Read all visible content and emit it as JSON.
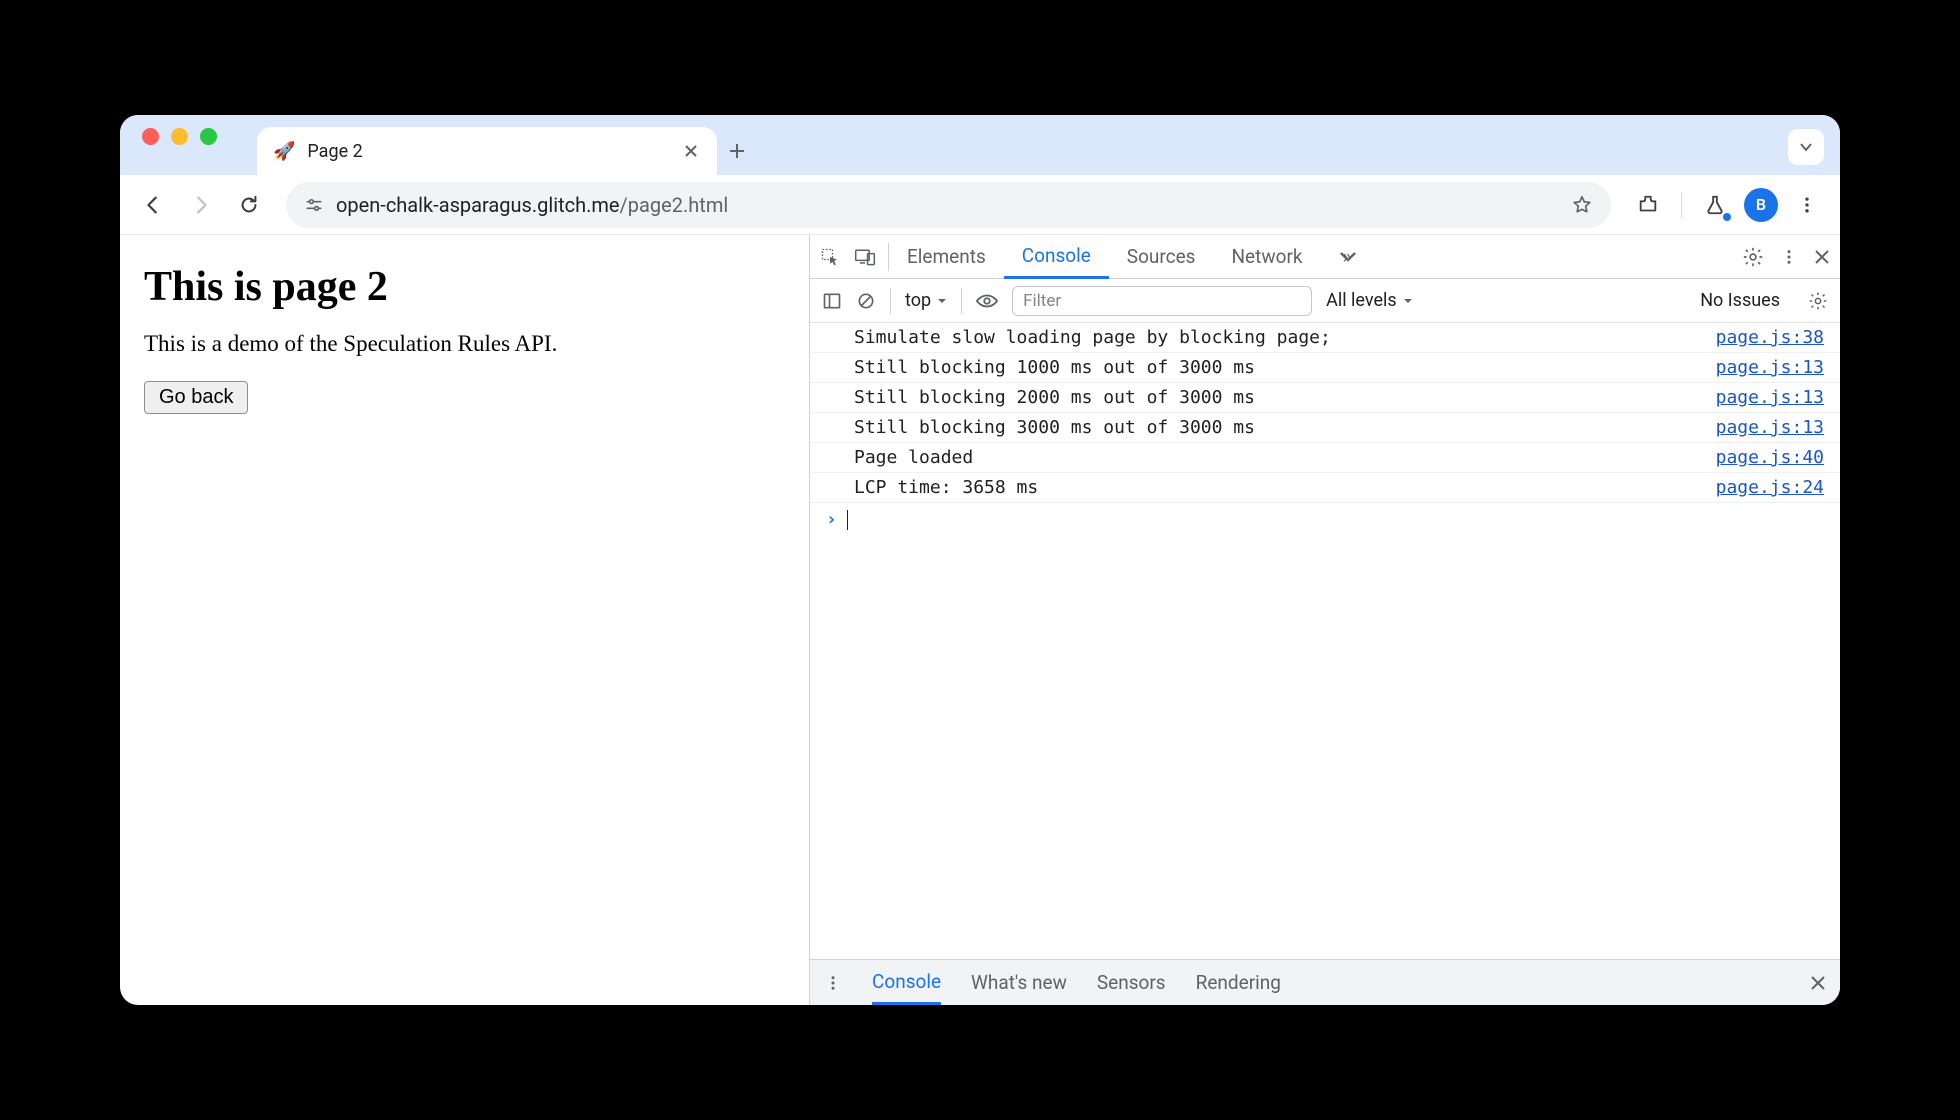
{
  "browser": {
    "tab": {
      "favicon": "🚀",
      "title": "Page 2"
    },
    "url_host": "open-chalk-asparagus.glitch.me",
    "url_path": "/page2.html",
    "avatar_letter": "B"
  },
  "page": {
    "heading": "This is page 2",
    "paragraph": "This is a demo of the Speculation Rules API.",
    "back_button": "Go back"
  },
  "devtools": {
    "tabs": [
      "Elements",
      "Console",
      "Sources",
      "Network"
    ],
    "active_tab": "Console",
    "toolbar": {
      "context": "top",
      "filter_placeholder": "Filter",
      "levels": "All levels",
      "issues": "No Issues"
    },
    "logs": [
      {
        "msg": "Simulate slow loading page by blocking page;",
        "src": "page.js:38"
      },
      {
        "msg": "Still blocking 1000 ms out of 3000 ms",
        "src": "page.js:13"
      },
      {
        "msg": "Still blocking 2000 ms out of 3000 ms",
        "src": "page.js:13"
      },
      {
        "msg": "Still blocking 3000 ms out of 3000 ms",
        "src": "page.js:13"
      },
      {
        "msg": "Page loaded",
        "src": "page.js:40"
      },
      {
        "msg": "LCP time: 3658 ms",
        "src": "page.js:24"
      }
    ],
    "drawer_tabs": [
      "Console",
      "What's new",
      "Sensors",
      "Rendering"
    ],
    "drawer_active": "Console"
  }
}
